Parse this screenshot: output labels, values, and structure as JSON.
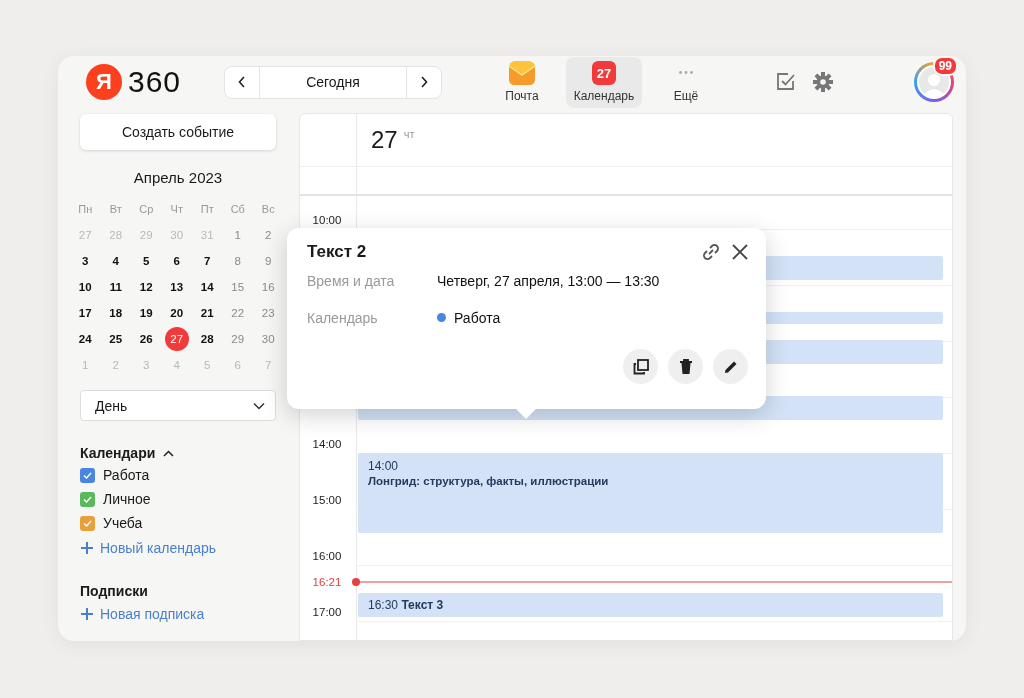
{
  "header": {
    "logo_letter": "Я",
    "logo_text": "360",
    "today_button": "Сегодня",
    "apps": [
      {
        "label": "Почта",
        "kind": "mail",
        "selected": false
      },
      {
        "label": "Календарь",
        "kind": "calendar",
        "badge": "27",
        "selected": true
      },
      {
        "label": "Ещё",
        "kind": "more",
        "selected": false
      }
    ],
    "avatar_badge": "99"
  },
  "sidebar": {
    "create_button": "Создать событие",
    "mini_calendar": {
      "title": "Апрель 2023",
      "weekdays": [
        "Пн",
        "Вт",
        "Ср",
        "Чт",
        "Пт",
        "Сб",
        "Вс"
      ],
      "weeks": [
        [
          {
            "day": "27",
            "kind": "outside",
            "selected": false
          },
          {
            "day": "28",
            "kind": "outside",
            "selected": false
          },
          {
            "day": "29",
            "kind": "outside",
            "selected": false
          },
          {
            "day": "30",
            "kind": "outside",
            "selected": false
          },
          {
            "day": "31",
            "kind": "outside",
            "selected": false
          },
          {
            "day": "1",
            "kind": "weekend",
            "selected": false
          },
          {
            "day": "2",
            "kind": "weekend",
            "selected": false
          }
        ],
        [
          {
            "day": "3",
            "kind": "workday",
            "selected": false
          },
          {
            "day": "4",
            "kind": "workday",
            "selected": false
          },
          {
            "day": "5",
            "kind": "workday",
            "selected": false
          },
          {
            "day": "6",
            "kind": "workday",
            "selected": false
          },
          {
            "day": "7",
            "kind": "workday",
            "selected": false
          },
          {
            "day": "8",
            "kind": "weekend",
            "selected": false
          },
          {
            "day": "9",
            "kind": "weekend",
            "selected": false
          }
        ],
        [
          {
            "day": "10",
            "kind": "workday",
            "selected": false
          },
          {
            "day": "11",
            "kind": "workday",
            "selected": false
          },
          {
            "day": "12",
            "kind": "workday",
            "selected": false
          },
          {
            "day": "13",
            "kind": "workday",
            "selected": false
          },
          {
            "day": "14",
            "kind": "workday",
            "selected": false
          },
          {
            "day": "15",
            "kind": "weekend",
            "selected": false
          },
          {
            "day": "16",
            "kind": "weekend",
            "selected": false
          }
        ],
        [
          {
            "day": "17",
            "kind": "workday",
            "selected": false
          },
          {
            "day": "18",
            "kind": "workday",
            "selected": false
          },
          {
            "day": "19",
            "kind": "workday",
            "selected": false
          },
          {
            "day": "20",
            "kind": "workday",
            "selected": false
          },
          {
            "day": "21",
            "kind": "workday",
            "selected": false
          },
          {
            "day": "22",
            "kind": "weekend",
            "selected": false
          },
          {
            "day": "23",
            "kind": "weekend",
            "selected": false
          }
        ],
        [
          {
            "day": "24",
            "kind": "workday",
            "selected": false
          },
          {
            "day": "25",
            "kind": "workday",
            "selected": false
          },
          {
            "day": "26",
            "kind": "workday",
            "selected": false
          },
          {
            "day": "27",
            "kind": "workday",
            "selected": true
          },
          {
            "day": "28",
            "kind": "workday",
            "selected": false
          },
          {
            "day": "29",
            "kind": "weekend",
            "selected": false
          },
          {
            "day": "30",
            "kind": "weekend",
            "selected": false
          }
        ],
        [
          {
            "day": "1",
            "kind": "outside",
            "selected": false
          },
          {
            "day": "2",
            "kind": "outside",
            "selected": false
          },
          {
            "day": "3",
            "kind": "outside",
            "selected": false
          },
          {
            "day": "4",
            "kind": "outside",
            "selected": false
          },
          {
            "day": "5",
            "kind": "outside",
            "selected": false
          },
          {
            "day": "6",
            "kind": "outside",
            "selected": false
          },
          {
            "day": "7",
            "kind": "outside",
            "selected": false
          }
        ]
      ]
    },
    "view_select": {
      "value": "День"
    },
    "calendars": {
      "title": "Календари",
      "expanded": true,
      "items": [
        {
          "label": "Работа",
          "color": "#4a86e0",
          "checked": true
        },
        {
          "label": "Личное",
          "color": "#5cb85c",
          "checked": true
        },
        {
          "label": "Учеба",
          "color": "#e8a03c",
          "checked": true
        }
      ],
      "add_link": "Новый календарь"
    },
    "subscriptions": {
      "title": "Подписки",
      "add_link": "Новая подписка"
    }
  },
  "day_view": {
    "date": "27",
    "weekday": "чт",
    "hours": [
      "10:00",
      "14:00",
      "15:00",
      "16:00",
      "17:00"
    ],
    "now": "16:21",
    "events": [
      {
        "kind": "covered"
      },
      {
        "kind": "covered"
      },
      {
        "kind": "covered"
      },
      {
        "kind": "covered"
      },
      {
        "kind": "block",
        "time": "14:00",
        "title": "Лонгрид: структура, факты, иллюстрации"
      },
      {
        "kind": "inline",
        "time": "16:30",
        "title": "Текст 3"
      }
    ]
  },
  "popover": {
    "title": "Текст 2",
    "fields": [
      {
        "label": "Время и дата",
        "value": "Четверг, 27 апреля, 13:00 — 13:30"
      },
      {
        "label": "Календарь",
        "value": "Работа",
        "color": "#4a86e0"
      }
    ]
  }
}
